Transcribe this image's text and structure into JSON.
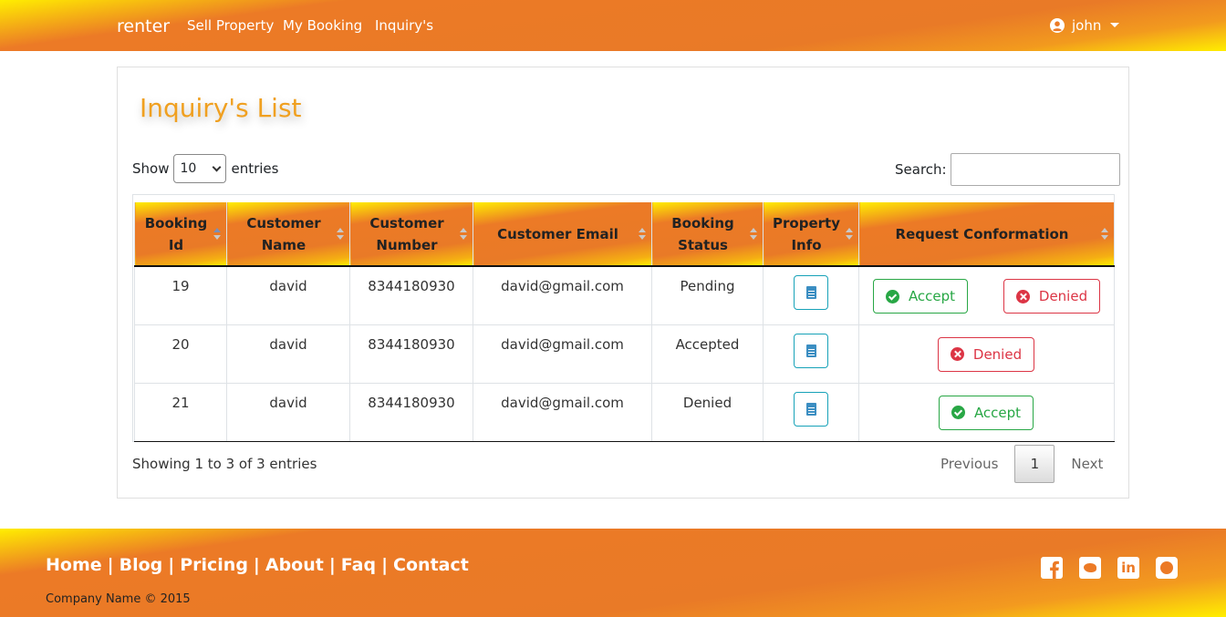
{
  "nav": {
    "brand": "renter",
    "links": [
      "Sell Property",
      "My Booking",
      "Inquiry's"
    ],
    "user": "john"
  },
  "page": {
    "title": "Inquiry's List"
  },
  "controls": {
    "show_label": "Show",
    "entries_value": "10",
    "entries_label": "entries",
    "search_label": "Search:"
  },
  "table": {
    "columns": [
      "Booking Id",
      "Customer Name",
      "Customer Number",
      "Customer Email",
      "Booking Status",
      "Property Info",
      "Request Conformation"
    ],
    "rows": [
      {
        "id": "19",
        "name": "david",
        "number": "8344180930",
        "email": "david@gmail.com",
        "status": "Pending"
      },
      {
        "id": "20",
        "name": "david",
        "number": "8344180930",
        "email": "david@gmail.com",
        "status": "Accepted"
      },
      {
        "id": "21",
        "name": "david",
        "number": "8344180930",
        "email": "david@gmail.com",
        "status": "Denied"
      }
    ],
    "accept_label": "Accept",
    "denied_label": "Denied"
  },
  "footer_info": {
    "showing": "Showing 1 to 3 of 3 entries",
    "previous": "Previous",
    "page": "1",
    "next": "Next"
  },
  "footer": {
    "links": [
      "Home",
      "Blog",
      "Pricing",
      "About",
      "Faq",
      "Contact"
    ],
    "separator": "|",
    "copyright": "Company Name © 2015",
    "socials": [
      "facebook-icon",
      "twitter-icon",
      "linkedin-icon",
      "github-icon"
    ],
    "linkedin_glyph": "in"
  },
  "colors": {
    "brand_orange": "#e97a27",
    "brand_yellow": "#ffee00",
    "title_color": "#f0a020",
    "accept": "#28a745",
    "denied": "#dc3545",
    "info": "#17a2b8"
  }
}
